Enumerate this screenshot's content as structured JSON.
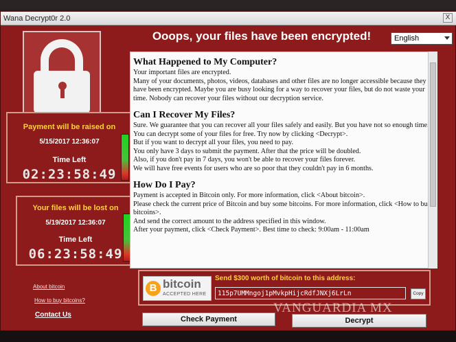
{
  "window": {
    "title": "Wana Decrypt0r 2.0",
    "close_glyph": "X"
  },
  "header": {
    "headline": "Ooops, your files have been encrypted!",
    "language": "English"
  },
  "timers": [
    {
      "heading": "Payment will be raised on",
      "date": "5/15/2017 12:36:07",
      "time_left_label": "Time Left",
      "countdown": "02:23:58:49",
      "level": 0.8
    },
    {
      "heading": "Your files will be lost on",
      "date": "5/19/2017 12:36:07",
      "time_left_label": "Time Left",
      "countdown": "06:23:58:49",
      "level": 0.85
    }
  ],
  "links": {
    "about_bitcoin": "About bitcoin",
    "how_to_buy": "How to buy bitcoins?",
    "contact": "Contact Us"
  },
  "message": {
    "h1": "What Happened to My Computer?",
    "p1": "Your important files are encrypted.",
    "p2": "Many of your documents, photos, videos, databases and other files are no longer accessible because they have been encrypted. Maybe you are busy looking for a way to recover your files, but do not waste your time. Nobody can recover your files without our decryption service.",
    "h2": "Can I Recover My Files?",
    "p3": "Sure. We guarantee that you can recover all your files safely and easily. But you have not so enough time.",
    "p4": "You can decrypt some of your files for free. Try now by clicking <Decrypt>.",
    "p5": "But if you want to decrypt all your files, you need to pay.",
    "p6": "You only have 3 days to submit the payment. After that the price will be doubled.",
    "p7": "Also, if you don't pay in 7 days, you won't be able to recover your files forever.",
    "p8": "We will have free events for users who are so poor that they couldn't pay in 6 months.",
    "h3": "How Do I Pay?",
    "p9": "Payment is accepted in Bitcoin only. For more information, click <About bitcoin>.",
    "p10": "Please check the current price of Bitcoin and buy some bitcoins. For more information, click <How to buy bitcoins>.",
    "p11": "And send the correct amount to the address specified in this window.",
    "p12": "After your payment, click <Check Payment>. Best time to check: 9:00am - 11:00am"
  },
  "payment": {
    "logo_word": "bitcoin",
    "logo_sub": "ACCEPTED HERE",
    "logo_symbol": "B",
    "instruction": "Send $300 worth of bitcoin to this address:",
    "address": "115p7UMMngoj1pMvkpHijcRdfJNXj6LrLn",
    "copy_label": "Copy"
  },
  "buttons": {
    "check_payment": "Check Payment",
    "decrypt": "Decrypt"
  },
  "watermark": "VANGUARDIA MX",
  "colors": {
    "window_red": "#8d1b1b",
    "accent_yellow": "#ffd23a",
    "bitcoin_orange": "#f7a21a"
  }
}
